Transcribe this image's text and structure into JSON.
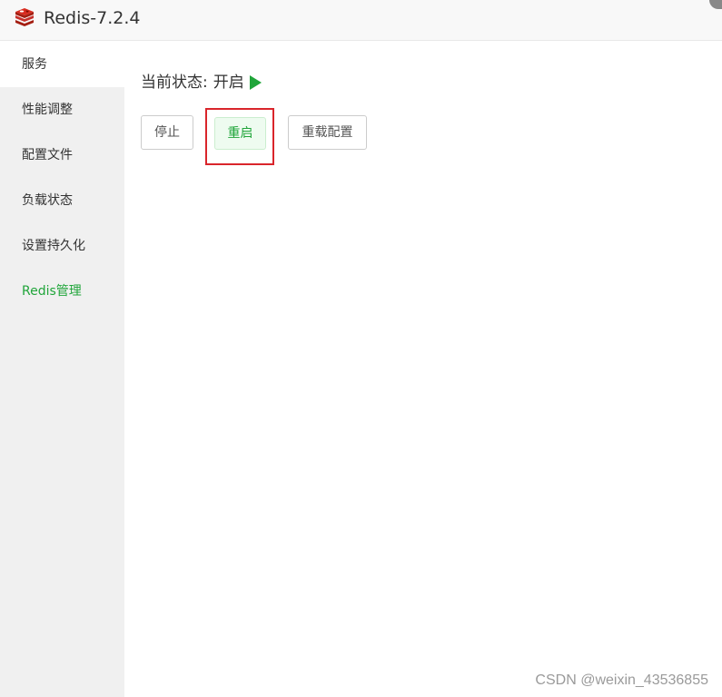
{
  "window": {
    "title": "Redis-7.2.4",
    "logo_icon": "redis-logo-icon",
    "accent_color": "#20a53a"
  },
  "sidebar": {
    "items": [
      {
        "label": "服务"
      },
      {
        "label": "性能调整"
      },
      {
        "label": "配置文件"
      },
      {
        "label": "负载状态"
      },
      {
        "label": "设置持久化"
      },
      {
        "label": "Redis管理"
      }
    ],
    "active_background_item": "服务",
    "selected_item": "Redis管理"
  },
  "main": {
    "status_label": "当前状态:",
    "status_value": "开启",
    "status_icon": "play-icon",
    "buttons": {
      "stop": "停止",
      "restart": "重启",
      "reload": "重载配置"
    }
  },
  "watermark": "CSDN @weixin_43536855"
}
